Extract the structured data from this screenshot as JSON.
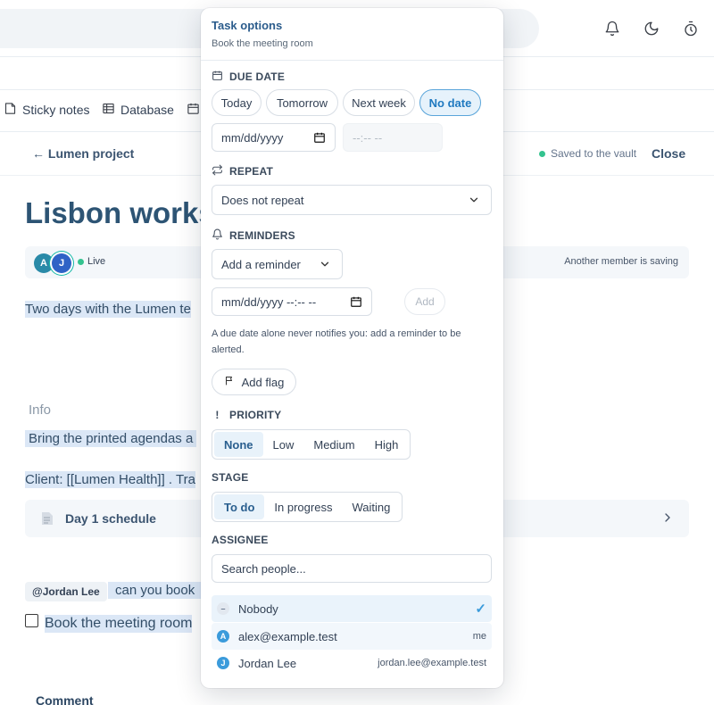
{
  "page": {
    "tabs": [
      {
        "label": "Sticky notes",
        "icon": "note-icon"
      },
      {
        "label": "Database",
        "icon": "table-icon"
      }
    ],
    "back_link": "← Lumen project",
    "saved_status": "Saved to the vault",
    "close_label": "Close",
    "title": "Lisbon works",
    "presence": {
      "avatars": [
        "A",
        "J"
      ],
      "live_label": "Live",
      "saving_status": "Another member is saving"
    },
    "paragraph_1": "Two days with the Lumen te",
    "info_label": "Info",
    "paragraph_2": "Bring the printed agendas a",
    "paragraph_3": "Client: [[Lumen Health]] . Tra",
    "schedule_card": "Day 1 schedule",
    "mention": "@Jordan Lee",
    "paragraph_4": "can you book",
    "task_text": "Book the meeting room",
    "comment_label": "Comment"
  },
  "popover": {
    "title": "Task options",
    "subtitle": "Book the meeting room",
    "due_date": {
      "label": "DUE DATE",
      "chips": [
        "Today",
        "Tomorrow",
        "Next week",
        "No date"
      ],
      "active_chip": "No date",
      "date_placeholder": "mm/dd/yyyy",
      "time_placeholder": "--:-- --"
    },
    "repeat": {
      "label": "REPEAT",
      "selected": "Does not repeat"
    },
    "reminders": {
      "label": "REMINDERS",
      "add_select": "Add a reminder",
      "datetime_placeholder": "mm/dd/yyyy --:-- --",
      "add_button": "Add",
      "hint": "A due date alone never notifies you: add a reminder to be alerted."
    },
    "flag_button": "Add flag",
    "priority": {
      "label": "PRIORITY",
      "options": [
        "None",
        "Low",
        "Medium",
        "High"
      ],
      "selected": "None"
    },
    "stage": {
      "label": "STAGE",
      "options": [
        "To do",
        "In progress",
        "Waiting"
      ],
      "selected": "To do"
    },
    "assignee": {
      "label": "ASSIGNEE",
      "search_placeholder": "Search people...",
      "people": [
        {
          "initial": "–",
          "name": "Nobody",
          "meta": "",
          "checked": true
        },
        {
          "initial": "A",
          "name": "alex@example.test",
          "meta": "me",
          "checked": false
        },
        {
          "initial": "J",
          "name": "Jordan Lee",
          "meta": "jordan.lee@example.test",
          "checked": false
        }
      ]
    }
  },
  "colors": {
    "accent": "#1f79c0",
    "title": "#2d5474",
    "highlight": "#dbe7f6",
    "live_dot": "#34c38f"
  }
}
